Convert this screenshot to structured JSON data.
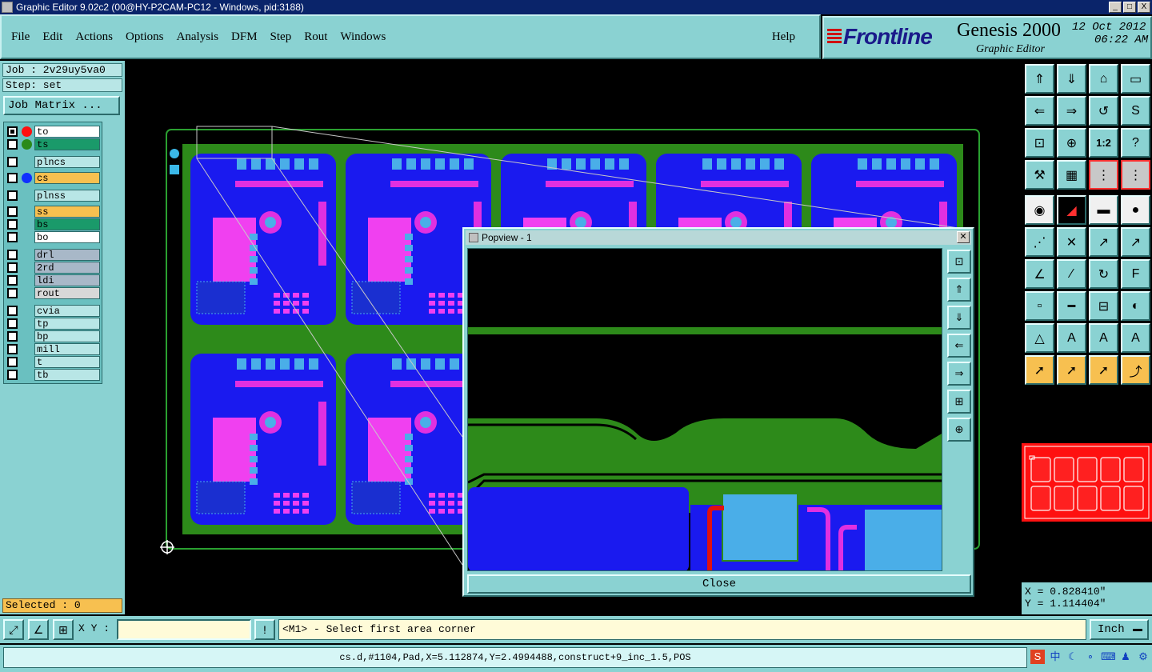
{
  "window": {
    "title": "Graphic Editor 9.02c2 (00@HY-P2CAM-PC12 - Windows, pid:3188)",
    "buttons": [
      "_",
      "□",
      "X"
    ]
  },
  "menu": {
    "items": [
      "File",
      "Edit",
      "Actions",
      "Options",
      "Analysis",
      "DFM",
      "Step",
      "Rout",
      "Windows"
    ],
    "help": "Help"
  },
  "brand": {
    "logo": "Frontline",
    "product": "Genesis 2000",
    "subtitle": "Graphic Editor",
    "date": "12 Oct 2012",
    "time": "06:22 AM"
  },
  "left": {
    "job": "Job : 2v29uy5va0",
    "step": "Step: set",
    "job_matrix": "Job Matrix ...",
    "layers": [
      {
        "name": "to",
        "bg": "#ffffff",
        "dot": "#ff1010",
        "checked": true
      },
      {
        "name": "ts",
        "bg": "#1a9a6a",
        "dot": "#2a8a1a",
        "checked": false
      },
      {
        "name": "plncs",
        "bg": "#b8e6e6",
        "dot": "",
        "checked": false
      },
      {
        "name": "cs",
        "bg": "#f7c050",
        "dot": "#1030ff",
        "checked": false
      },
      {
        "name": "plnss",
        "bg": "#b8e6e6",
        "dot": "",
        "checked": false
      },
      {
        "name": "ss",
        "bg": "#f7c050",
        "dot": "",
        "checked": false
      },
      {
        "name": "bs",
        "bg": "#1a9a6a",
        "dot": "",
        "checked": false
      },
      {
        "name": "bo",
        "bg": "#ffffff",
        "dot": "",
        "checked": false
      },
      {
        "name": "drl",
        "bg": "#a8b8c8",
        "dot": "",
        "checked": false
      },
      {
        "name": "2rd",
        "bg": "#a8b8c8",
        "dot": "",
        "checked": false
      },
      {
        "name": "ldi",
        "bg": "#a8b8c8",
        "dot": "",
        "checked": false
      },
      {
        "name": "rout",
        "bg": "#d8d8d8",
        "dot": "",
        "checked": false
      },
      {
        "name": "cvia",
        "bg": "#b8e6e6",
        "dot": "",
        "checked": false
      },
      {
        "name": "tp",
        "bg": "#b8e6e6",
        "dot": "",
        "checked": false
      },
      {
        "name": "bp",
        "bg": "#b8e6e6",
        "dot": "",
        "checked": false
      },
      {
        "name": "mill",
        "bg": "#b8e6e6",
        "dot": "",
        "checked": false
      },
      {
        "name": "t",
        "bg": "#b8e6e6",
        "dot": "",
        "checked": false
      },
      {
        "name": "tb",
        "bg": "#b8e6e6",
        "dot": "",
        "checked": false
      }
    ],
    "selected": "Selected : 0"
  },
  "popview": {
    "title": "Popview - 1",
    "close_label": "Close"
  },
  "coords": {
    "x": "X = 0.828410\"",
    "y": "Y = 1.114404\""
  },
  "command": {
    "xy_label": "X Y :",
    "xy_value": "",
    "prompt": "<M1> - Select first area corner",
    "unit": "Inch"
  },
  "status": {
    "text": "cs.d,#1104,Pad,X=5.112874,Y=2.4994488,construct+9_inc_1.5,POS"
  },
  "toolbox": {
    "labels": [
      "1:2",
      "?"
    ]
  }
}
